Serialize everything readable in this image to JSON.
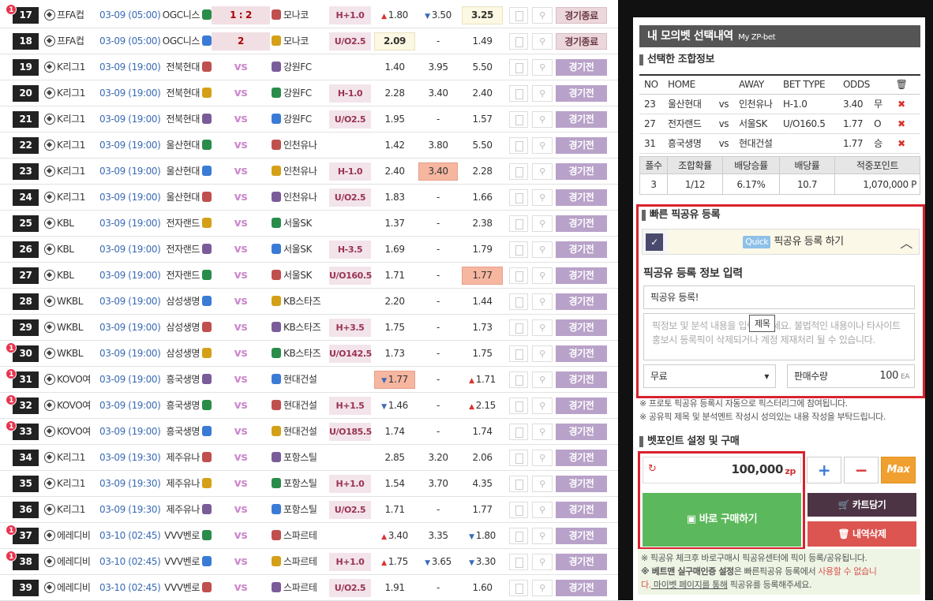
{
  "rows": [
    {
      "no": "17",
      "badge": "1",
      "league": "프FA컵",
      "date": "03-09 (05:00)",
      "home": "OGC니스",
      "away": "모나코",
      "score": "1 : 2",
      "type": "H+1.0",
      "o1": "1.80",
      "o1_dir": "up",
      "o2": "3.50",
      "o2_dir": "dn",
      "o3": "3.25",
      "o3_hl": "y",
      "status": "경기종료",
      "status_end": true
    },
    {
      "no": "18",
      "badge": "",
      "league": "프FA컵",
      "date": "03-09 (05:00)",
      "home": "OGC니스",
      "away": "모나코",
      "score": "2",
      "type": "U/O2.5",
      "o1": "2.09",
      "o1_hl": "y",
      "o2": "-",
      "o3": "1.49",
      "status": "경기종료",
      "status_end": true
    },
    {
      "no": "19",
      "badge": "",
      "league": "K리그1",
      "date": "03-09 (19:00)",
      "home": "전북현대",
      "away": "강원FC",
      "vs": "vs",
      "type": "",
      "o1": "1.40",
      "o2": "3.95",
      "o3": "5.50",
      "status": "경기전"
    },
    {
      "no": "20",
      "badge": "",
      "league": "K리그1",
      "date": "03-09 (19:00)",
      "home": "전북현대",
      "away": "강원FC",
      "vs": "vs",
      "type": "H-1.0",
      "o1": "2.28",
      "o2": "3.40",
      "o3": "2.40",
      "status": "경기전"
    },
    {
      "no": "21",
      "badge": "",
      "league": "K리그1",
      "date": "03-09 (19:00)",
      "home": "전북현대",
      "away": "강원FC",
      "vs": "vs",
      "type": "U/O2.5",
      "o1": "1.95",
      "o2": "-",
      "o3": "1.57",
      "status": "경기전"
    },
    {
      "no": "22",
      "badge": "",
      "league": "K리그1",
      "date": "03-09 (19:00)",
      "home": "울산현대",
      "away": "인천유나",
      "vs": "vs",
      "type": "",
      "o1": "1.42",
      "o2": "3.80",
      "o3": "5.50",
      "status": "경기전"
    },
    {
      "no": "23",
      "badge": "",
      "league": "K리그1",
      "date": "03-09 (19:00)",
      "home": "울산현대",
      "away": "인천유나",
      "vs": "vs",
      "type": "H-1.0",
      "o1": "2.40",
      "o2": "3.40",
      "o2_hr": "y",
      "o3": "2.28",
      "status": "경기전"
    },
    {
      "no": "24",
      "badge": "",
      "league": "K리그1",
      "date": "03-09 (19:00)",
      "home": "울산현대",
      "away": "인천유나",
      "vs": "vs",
      "type": "U/O2.5",
      "o1": "1.83",
      "o2": "-",
      "o3": "1.66",
      "status": "경기전"
    },
    {
      "no": "25",
      "badge": "",
      "league": "KBL",
      "date": "03-09 (19:00)",
      "home": "전자랜드",
      "away": "서울SK",
      "vs": "vs",
      "type": "",
      "o1": "1.37",
      "o2": "-",
      "o3": "2.38",
      "status": "경기전"
    },
    {
      "no": "26",
      "badge": "",
      "league": "KBL",
      "date": "03-09 (19:00)",
      "home": "전자랜드",
      "away": "서울SK",
      "vs": "vs",
      "type": "H-3.5",
      "o1": "1.69",
      "o2": "-",
      "o3": "1.79",
      "status": "경기전"
    },
    {
      "no": "27",
      "badge": "",
      "league": "KBL",
      "date": "03-09 (19:00)",
      "home": "전자랜드",
      "away": "서울SK",
      "vs": "vs",
      "type": "U/O160.5",
      "o1": "1.71",
      "o2": "-",
      "o3": "1.77",
      "o3_hr": "y",
      "status": "경기전"
    },
    {
      "no": "28",
      "badge": "",
      "league": "WKBL",
      "date": "03-09 (19:00)",
      "home": "삼성생명",
      "away": "KB스타즈",
      "vs": "vs",
      "type": "",
      "o1": "2.20",
      "o2": "-",
      "o3": "1.44",
      "status": "경기전"
    },
    {
      "no": "29",
      "badge": "",
      "league": "WKBL",
      "date": "03-09 (19:00)",
      "home": "삼성생명",
      "away": "KB스타즈",
      "vs": "vs",
      "type": "H+3.5",
      "o1": "1.75",
      "o2": "-",
      "o3": "1.73",
      "status": "경기전"
    },
    {
      "no": "30",
      "badge": "1",
      "league": "WKBL",
      "date": "03-09 (19:00)",
      "home": "삼성생명",
      "away": "KB스타즈",
      "vs": "vs",
      "type": "U/O142.5",
      "o1": "1.73",
      "o2": "-",
      "o3": "1.75",
      "status": "경기전"
    },
    {
      "no": "31",
      "badge": "1",
      "league": "KOVO여",
      "date": "03-09 (19:00)",
      "home": "흥국생명",
      "away": "현대건설",
      "vs": "vs",
      "type": "",
      "o1": "1.77",
      "o1_dir": "dn",
      "o1_hr": "y",
      "o2": "-",
      "o3": "1.71",
      "o3_dir": "up",
      "status": "경기전"
    },
    {
      "no": "32",
      "badge": "1",
      "league": "KOVO여",
      "date": "03-09 (19:00)",
      "home": "흥국생명",
      "away": "현대건설",
      "vs": "vs",
      "type": "H+1.5",
      "o1": "1.46",
      "o1_dir": "dn",
      "o2": "-",
      "o3": "2.15",
      "o3_dir": "up",
      "status": "경기전"
    },
    {
      "no": "33",
      "badge": "1",
      "league": "KOVO여",
      "date": "03-09 (19:00)",
      "home": "흥국생명",
      "away": "현대건설",
      "vs": "vs",
      "type": "U/O185.5",
      "o1": "1.74",
      "o2": "-",
      "o3": "1.74",
      "status": "경기전"
    },
    {
      "no": "34",
      "badge": "",
      "league": "K리그1",
      "date": "03-09 (19:30)",
      "home": "제주유나",
      "away": "포항스틸",
      "vs": "vs",
      "type": "",
      "o1": "2.85",
      "o2": "3.20",
      "o3": "2.06",
      "status": "경기전"
    },
    {
      "no": "35",
      "badge": "",
      "league": "K리그1",
      "date": "03-09 (19:30)",
      "home": "제주유나",
      "away": "포항스틸",
      "vs": "vs",
      "type": "H+1.0",
      "o1": "1.54",
      "o2": "3.70",
      "o3": "4.35",
      "status": "경기전"
    },
    {
      "no": "36",
      "badge": "",
      "league": "K리그1",
      "date": "03-09 (19:30)",
      "home": "제주유나",
      "away": "포항스틸",
      "vs": "vs",
      "type": "U/O2.5",
      "o1": "1.71",
      "o2": "-",
      "o3": "1.77",
      "status": "경기전"
    },
    {
      "no": "37",
      "badge": "1",
      "league": "에레디비",
      "date": "03-10 (02:45)",
      "home": "VVV벤로",
      "away": "스파르테",
      "vs": "vs",
      "type": "",
      "o1": "3.40",
      "o1_dir": "up",
      "o2": "3.35",
      "o3": "1.80",
      "o3_dir": "dn",
      "status": "경기전"
    },
    {
      "no": "38",
      "badge": "1",
      "league": "에레디비",
      "date": "03-10 (02:45)",
      "home": "VVV벤로",
      "away": "스파르테",
      "vs": "vs",
      "type": "H+1.0",
      "o1": "1.75",
      "o1_dir": "up",
      "o2": "3.65",
      "o2_dir": "dn",
      "o3": "3.30",
      "o3_dir": "dn",
      "status": "경기전"
    },
    {
      "no": "39",
      "badge": "",
      "league": "에레디비",
      "date": "03-10 (02:45)",
      "home": "VVV벤로",
      "away": "스파르테",
      "vs": "vs",
      "type": "U/O2.5",
      "o1": "1.91",
      "o2": "-",
      "o3": "1.60",
      "status": "경기전"
    }
  ],
  "panel": {
    "title": "내 모의벳 선택내역",
    "title_small": "My ZP-bet",
    "combo_header": "선택한 조합정보",
    "bet_cols": [
      "NO",
      "HOME",
      "AWAY",
      "BET TYPE",
      "ODDS"
    ],
    "bets": [
      {
        "no": "23",
        "home": "울산현대",
        "vs": "vs",
        "away": "인천유나",
        "type": "H-1.0",
        "odds": "3.40",
        "pick": "무"
      },
      {
        "no": "27",
        "home": "전자랜드",
        "vs": "vs",
        "away": "서울SK",
        "type": "U/O160.5",
        "odds": "1.77",
        "pick": "O"
      },
      {
        "no": "31",
        "home": "흥국생명",
        "vs": "vs",
        "away": "현대건설",
        "type": "",
        "odds": "1.77",
        "pick": "승"
      }
    ],
    "stat_cols": [
      "폴수",
      "조합확률",
      "배당승률",
      "배당률",
      "적중포인트"
    ],
    "stats": [
      "3",
      "1/12",
      "6.17%",
      "10.7",
      "1,070,000 P"
    ],
    "quick_header": "빠른 픽공유 등록",
    "quick_tag": "Quick",
    "quick_bar": "픽공유 등록 하기",
    "quick_label": "픽공유 등록 정보 입력",
    "title_value": "픽공유 등록!",
    "tooltip": "제목",
    "text_placeholder": "픽정보 및 분석 내용을 입력해주세요. 불법적인 내용이나 타사이트 홍보시 등록픽이 삭제되거나 계정 제재처리 될 수 있습니다.",
    "price_select": "무료",
    "qty_label": "판매수량",
    "qty_value": "100",
    "qty_unit": "EA",
    "note1": "※ 프로토 픽공유 등록시 자동으로 픽스터리그에 참여됩니다.",
    "note2": "※ 공유픽 제목 및 분석멘트 작성시 성의있는 내용 작성을 부탁드립니다.",
    "bet_header": "벳포인트 설정 및 구매",
    "amount": "100,000",
    "amount_unit": "zp",
    "plus": "+",
    "minus": "−",
    "max": "Max",
    "buy": "바로 구매하기",
    "cart": "카트담기",
    "delete": "내역삭제",
    "foot1": "※ 픽공유 체크후 바로구매시 픽공유센터에 픽이 등록/공유됩니다.",
    "foot2a": "※ 베트맨 실구매인증 설정",
    "foot2b": "은 빠른픽공유 등록에서 ",
    "foot2c": "사용할 수 없습니",
    "foot3a": "다.",
    "foot3b": " 마이벳 페이지를 통해",
    "foot3c": " 픽공유를 등록해주세요."
  },
  "colors": {
    "accent": "#b9a2c9",
    "danger": "#d9222e",
    "buy": "#5cb85c",
    "max": "#f0a030"
  }
}
